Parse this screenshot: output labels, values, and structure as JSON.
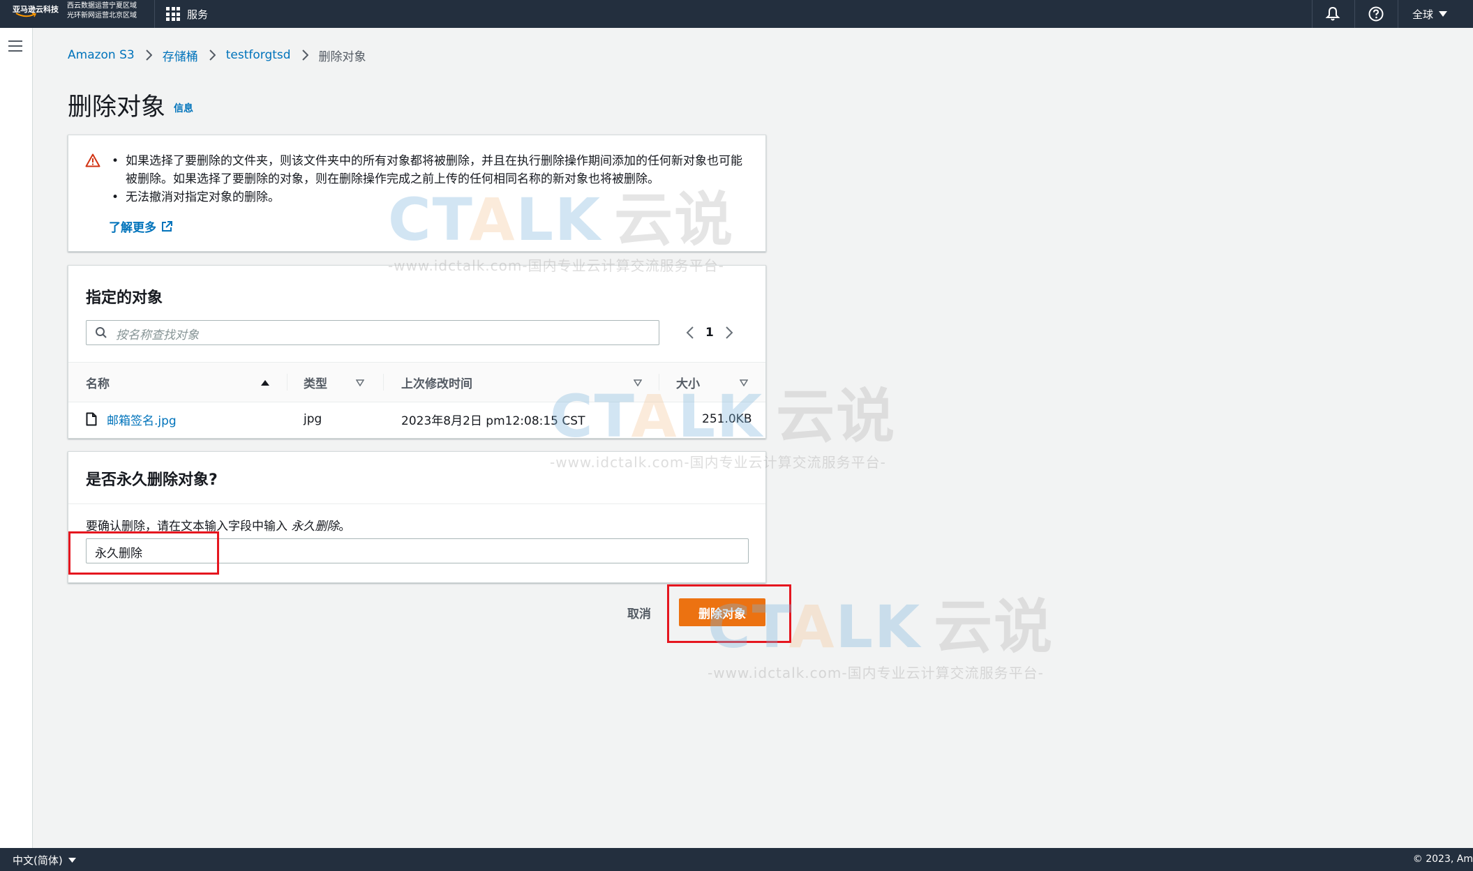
{
  "topbar": {
    "logo_text": "亚马逊云科技",
    "region_line1": "西云数据运营宁夏区域",
    "region_line2": "光环新网运营北京区域",
    "services_label": "服务",
    "region_select": "全球"
  },
  "breadcrumb": {
    "items": [
      "Amazon S3",
      "存储桶",
      "testforgtsd"
    ],
    "current": "删除对象"
  },
  "page": {
    "title": "删除对象",
    "info_link": "信息"
  },
  "alert": {
    "bullets": [
      "如果选择了要删除的文件夹，则该文件夹中的所有对象都将被删除，并且在执行删除操作期间添加的任何新对象也可能被删除。如果选择了要删除的对象，则在删除操作完成之前上传的任何相同名称的新对象也将被删除。",
      "无法撤消对指定对象的删除。"
    ],
    "learn_more": "了解更多",
    "icon": "warning-icon",
    "color": "#d13212"
  },
  "objects_panel": {
    "title": "指定的对象",
    "search_placeholder": "按名称查找对象",
    "page_number": "1",
    "columns": [
      "名称",
      "类型",
      "上次修改时间",
      "大小"
    ],
    "rows": [
      {
        "name": "邮箱签名.jpg",
        "type": "jpg",
        "modified": "2023年8月2日 pm12:08:15 CST",
        "size": "251.0KB"
      }
    ]
  },
  "confirm_panel": {
    "title": "是否永久删除对象?",
    "instruction_prefix": "要确认删除，请在文本输入字段中输入 ",
    "instruction_keyword": "永久删除",
    "instruction_suffix": "。",
    "input_value": "永久删除"
  },
  "actions": {
    "cancel": "取消",
    "delete": "删除对象",
    "delete_color": "#ec7211"
  },
  "watermark": {
    "logo_part1": "C",
    "logo_part2": "T",
    "logo_part3": "A",
    "logo_part4": "LK",
    "logo_cn": "云说",
    "subtitle": "-www.idctalk.com-国内专业云计算交流服务平台-"
  },
  "footer": {
    "language": "中文(简体)",
    "copyright": "© 2023, Am"
  }
}
